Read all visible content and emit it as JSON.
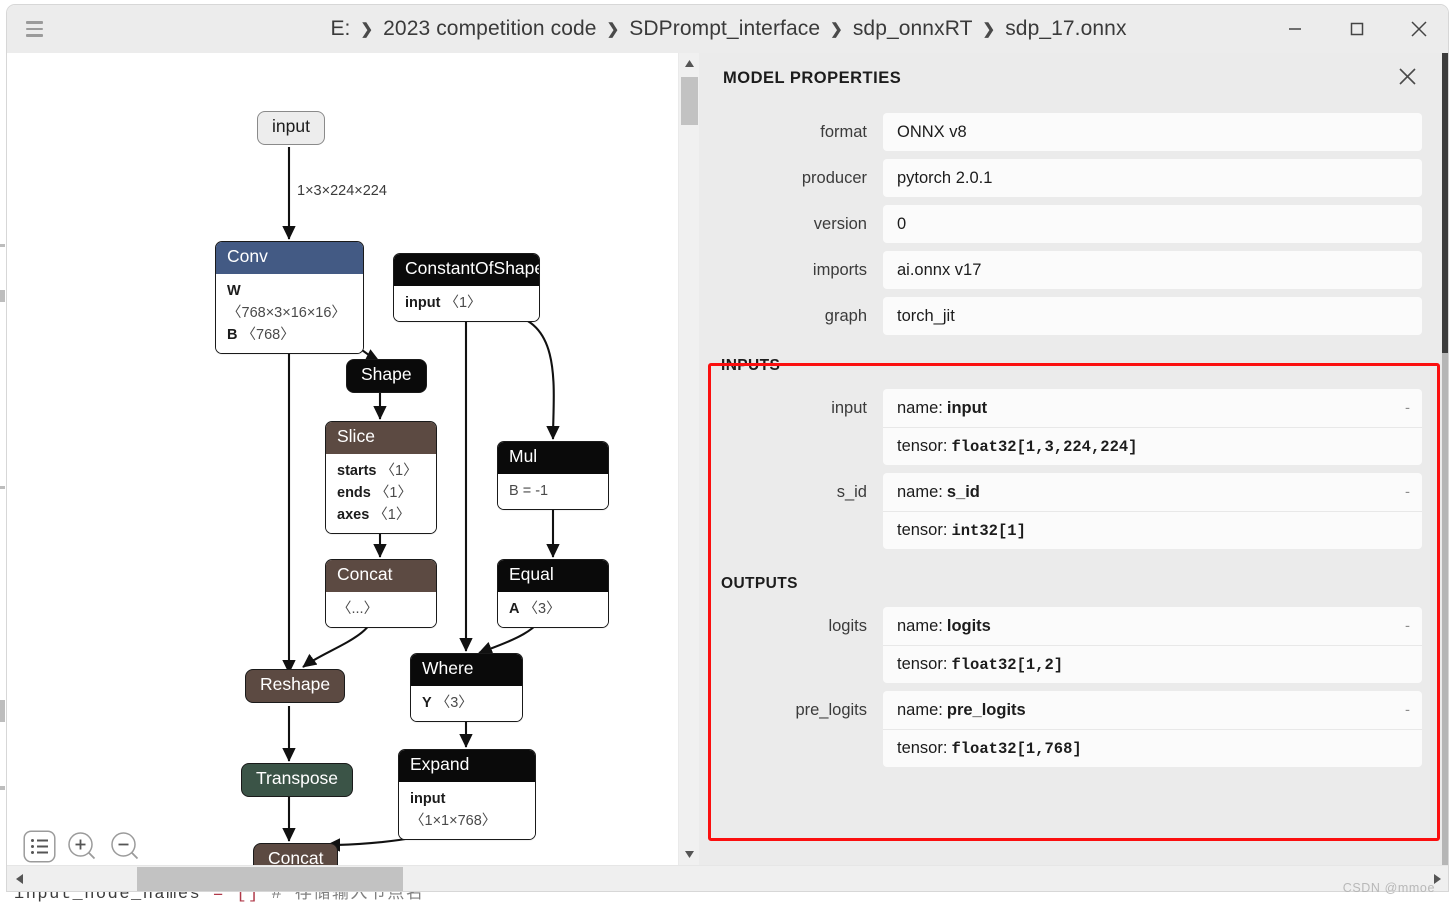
{
  "window": {
    "menu_icon": "hamburger-icon",
    "breadcrumb": [
      "E:",
      "2023 competition code",
      "SDPrompt_interface",
      "sdp_onnxRT",
      "sdp_17.onnx"
    ],
    "separator": "❯",
    "controls": {
      "minimize": "minimize-icon",
      "maximize": "maximize-icon",
      "close": "close-icon"
    }
  },
  "background": {
    "code_line_prefix": "input_node_names ",
    "code_line_keyword": "= []",
    "code_line_comment": "  # 存储输入节点名"
  },
  "graph": {
    "edge_labels": {
      "input_to_conv": "1×3×224×224"
    },
    "nodes": [
      {
        "id": "input",
        "kind": "io",
        "title": "input"
      },
      {
        "id": "conv",
        "kind": "box",
        "title": "Conv",
        "color": "#435a84",
        "attrs": [
          {
            "k": "W",
            "v": "〈768×3×16×16〉"
          },
          {
            "k": "B",
            "v": "〈768〉"
          }
        ]
      },
      {
        "id": "constantofshape",
        "kind": "box",
        "title": "ConstantOfShape",
        "color": "#0a0a0a",
        "attrs": [
          {
            "k": "input",
            "v": "〈1〉"
          }
        ]
      },
      {
        "id": "shape",
        "kind": "pill",
        "title": "Shape",
        "color": "#0a0a0a"
      },
      {
        "id": "slice",
        "kind": "box",
        "title": "Slice",
        "color": "#5c4a42",
        "attrs": [
          {
            "k": "starts",
            "v": "〈1〉"
          },
          {
            "k": "ends",
            "v": "〈1〉"
          },
          {
            "k": "axes",
            "v": "〈1〉"
          }
        ]
      },
      {
        "id": "mul",
        "kind": "box",
        "title": "Mul",
        "color": "#0a0a0a",
        "attrs": [
          {
            "k": "",
            "v": "B = -1"
          }
        ]
      },
      {
        "id": "concat1",
        "kind": "box",
        "title": "Concat",
        "color": "#5c4a42",
        "attrs": [
          {
            "k": "",
            "v": "〈...〉"
          }
        ]
      },
      {
        "id": "equal",
        "kind": "box",
        "title": "Equal",
        "color": "#0a0a0a",
        "attrs": [
          {
            "k": "A",
            "v": "〈3〉"
          }
        ]
      },
      {
        "id": "reshape",
        "kind": "pill",
        "title": "Reshape",
        "color": "#5c4a42"
      },
      {
        "id": "where",
        "kind": "box",
        "title": "Where",
        "color": "#0a0a0a",
        "attrs": [
          {
            "k": "Y",
            "v": "〈3〉"
          }
        ]
      },
      {
        "id": "transpose",
        "kind": "pill",
        "title": "Transpose",
        "color": "#3b5447"
      },
      {
        "id": "expand",
        "kind": "box",
        "title": "Expand",
        "color": "#0a0a0a",
        "attrs": [
          {
            "k": "input",
            "v": "〈1×1×768〉"
          }
        ]
      },
      {
        "id": "concat2",
        "kind": "pill",
        "title": "Concat",
        "color": "#5c4a42"
      }
    ],
    "toolbar": {
      "list_label": "properties-list",
      "zoom_in_label": "zoom-in",
      "zoom_out_label": "zoom-out"
    }
  },
  "properties": {
    "title": "MODEL PROPERTIES",
    "close_label": "close-properties",
    "fields": [
      {
        "label": "format",
        "value": "ONNX v8"
      },
      {
        "label": "producer",
        "value": "pytorch 2.0.1"
      },
      {
        "label": "version",
        "value": "0"
      },
      {
        "label": "imports",
        "value": "ai.onnx v17"
      },
      {
        "label": "graph",
        "value": "torch_jit"
      }
    ],
    "inputs_title": "INPUTS",
    "inputs": [
      {
        "label": "input",
        "name_prefix": "name:",
        "name": "input",
        "tensor_prefix": "tensor:",
        "tensor": "float32[1,3,224,224]",
        "collapse": "-"
      },
      {
        "label": "s_id",
        "name_prefix": "name:",
        "name": "s_id",
        "tensor_prefix": "tensor:",
        "tensor": "int32[1]",
        "collapse": "-"
      }
    ],
    "outputs_title": "OUTPUTS",
    "outputs": [
      {
        "label": "logits",
        "name_prefix": "name:",
        "name": "logits",
        "tensor_prefix": "tensor:",
        "tensor": "float32[1,2]",
        "collapse": "-"
      },
      {
        "label": "pre_logits",
        "name_prefix": "name:",
        "name": "pre_logits",
        "tensor_prefix": "tensor:",
        "tensor": "float32[1,768]",
        "collapse": "-"
      }
    ],
    "highlight_color": "#fb0f0f"
  },
  "watermark": "CSDN @mmoe"
}
